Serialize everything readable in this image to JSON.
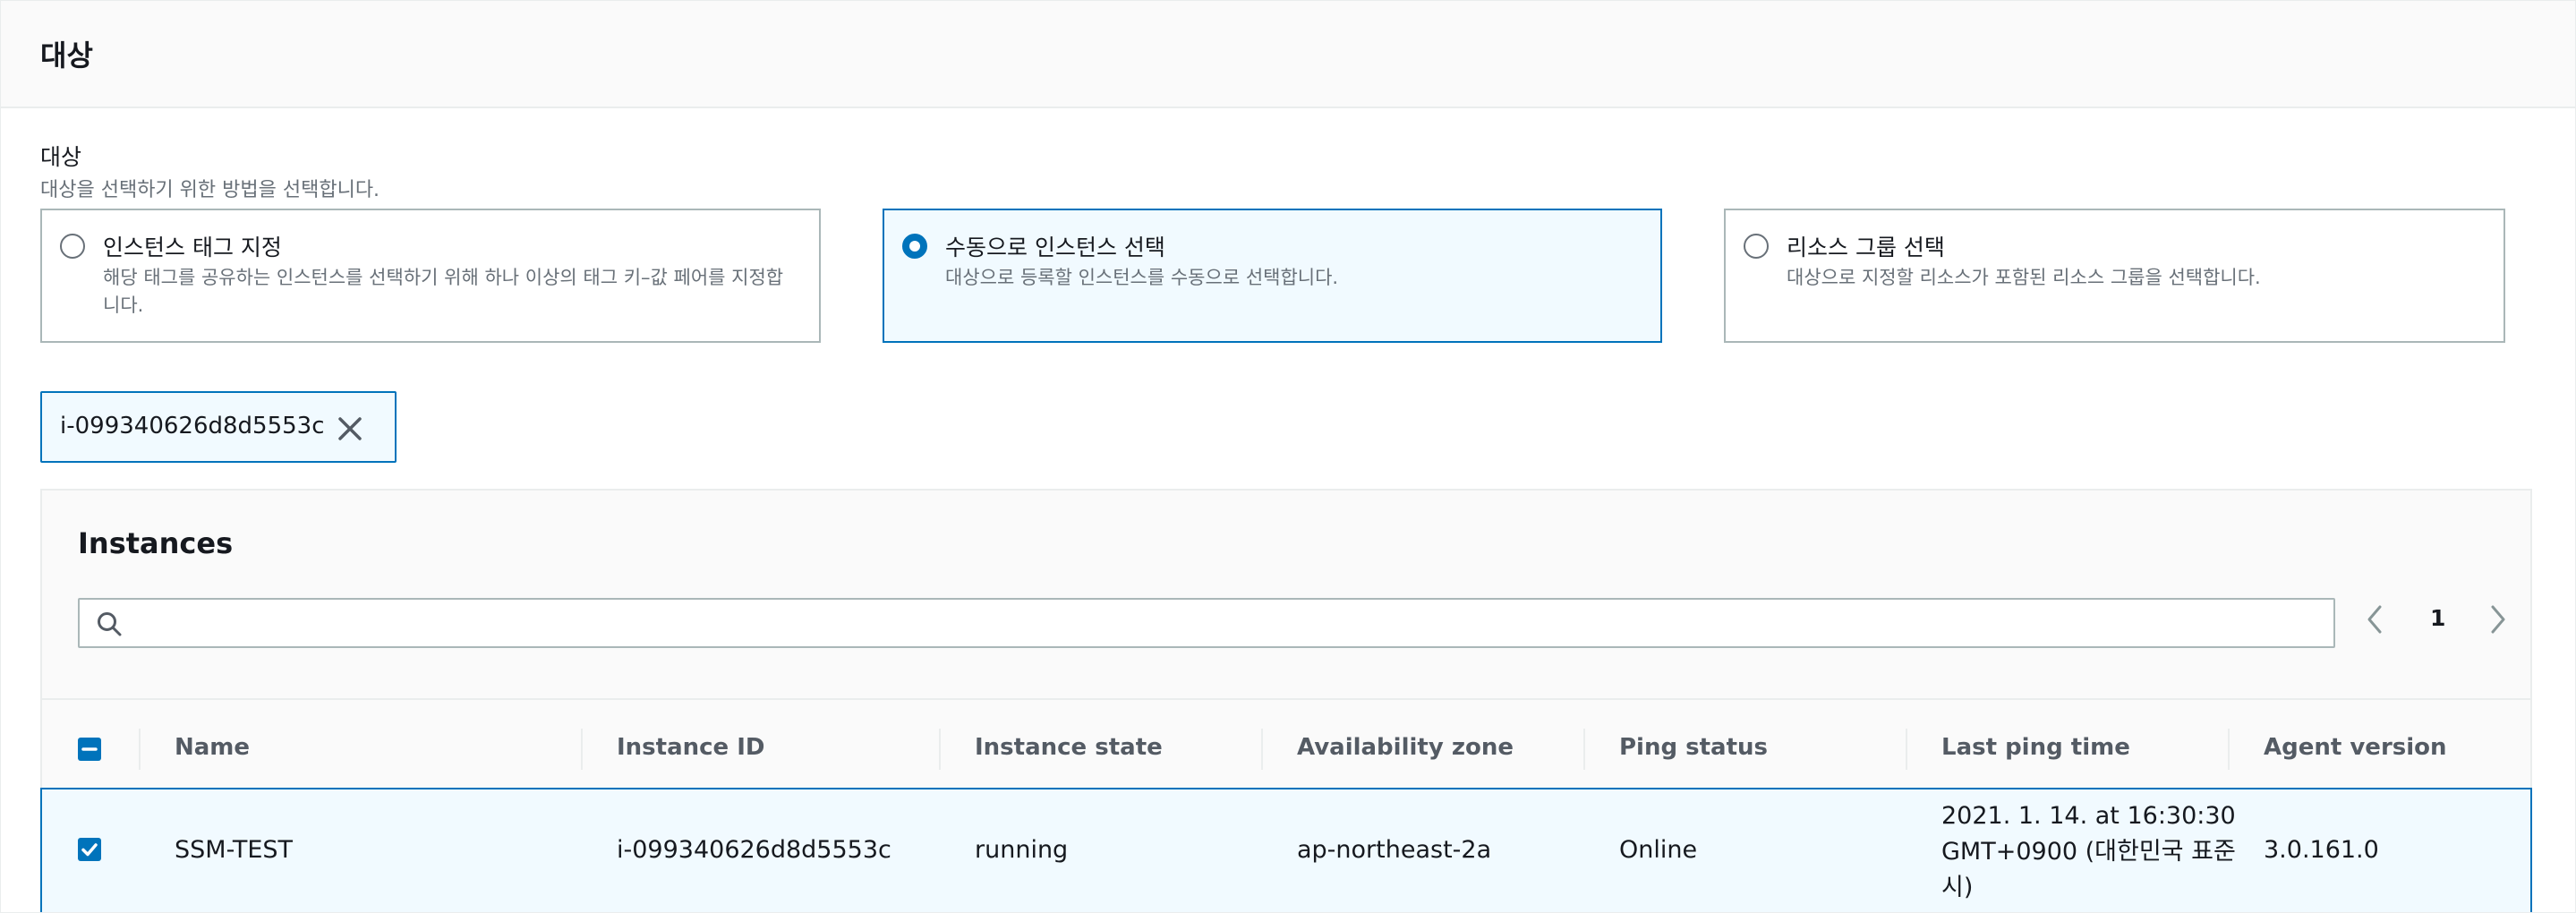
{
  "section": {
    "title": "대상",
    "field_label": "대상",
    "field_description": "대상을 선택하기 위한 방법을 선택합니다."
  },
  "target_options": [
    {
      "title": "인스턴스 태그 지정",
      "description": "해당 태그를 공유하는 인스턴스를 선택하기 위해 하나 이상의 태그 키–값 페어를 지정합니다.",
      "selected": false
    },
    {
      "title": "수동으로 인스턴스 선택",
      "description": "대상으로 등록할 인스턴스를 수동으로 선택합니다.",
      "selected": true
    },
    {
      "title": "리소스 그룹 선택",
      "description": "대상으로 지정할 리소스가 포함된 리소스 그룹을 선택합니다.",
      "selected": false
    }
  ],
  "selected_token": {
    "label": "i-099340626d8d5553c",
    "remove_icon": "close-icon"
  },
  "instances": {
    "title": "Instances",
    "search": {
      "placeholder": "",
      "value": "",
      "icon": "search-icon"
    },
    "pagination": {
      "current_page": "1",
      "prev_icon": "chevron-left-icon",
      "next_icon": "chevron-right-icon"
    },
    "columns": [
      "Name",
      "Instance ID",
      "Instance state",
      "Availability zone",
      "Ping status",
      "Last ping time",
      "Agent version"
    ],
    "header_checkbox_state": "indeterminate",
    "rows": [
      {
        "selected": true,
        "name": "SSM-TEST",
        "instance_id": "i-099340626d8d5553c",
        "instance_state": "running",
        "availability_zone": "ap-northeast-2a",
        "ping_status": "Online",
        "last_ping_time": "2021. 1. 14. at 16:30:30 GMT+0900 (대한민국 표준시)",
        "agent_version": "3.0.161.0"
      }
    ]
  },
  "colors": {
    "accent": "#0073bb",
    "selected_background": "#f1faff",
    "border": "#aab7b8",
    "muted_text": "#687078",
    "header_text": "#545b64",
    "panel_background": "#fafafa"
  }
}
